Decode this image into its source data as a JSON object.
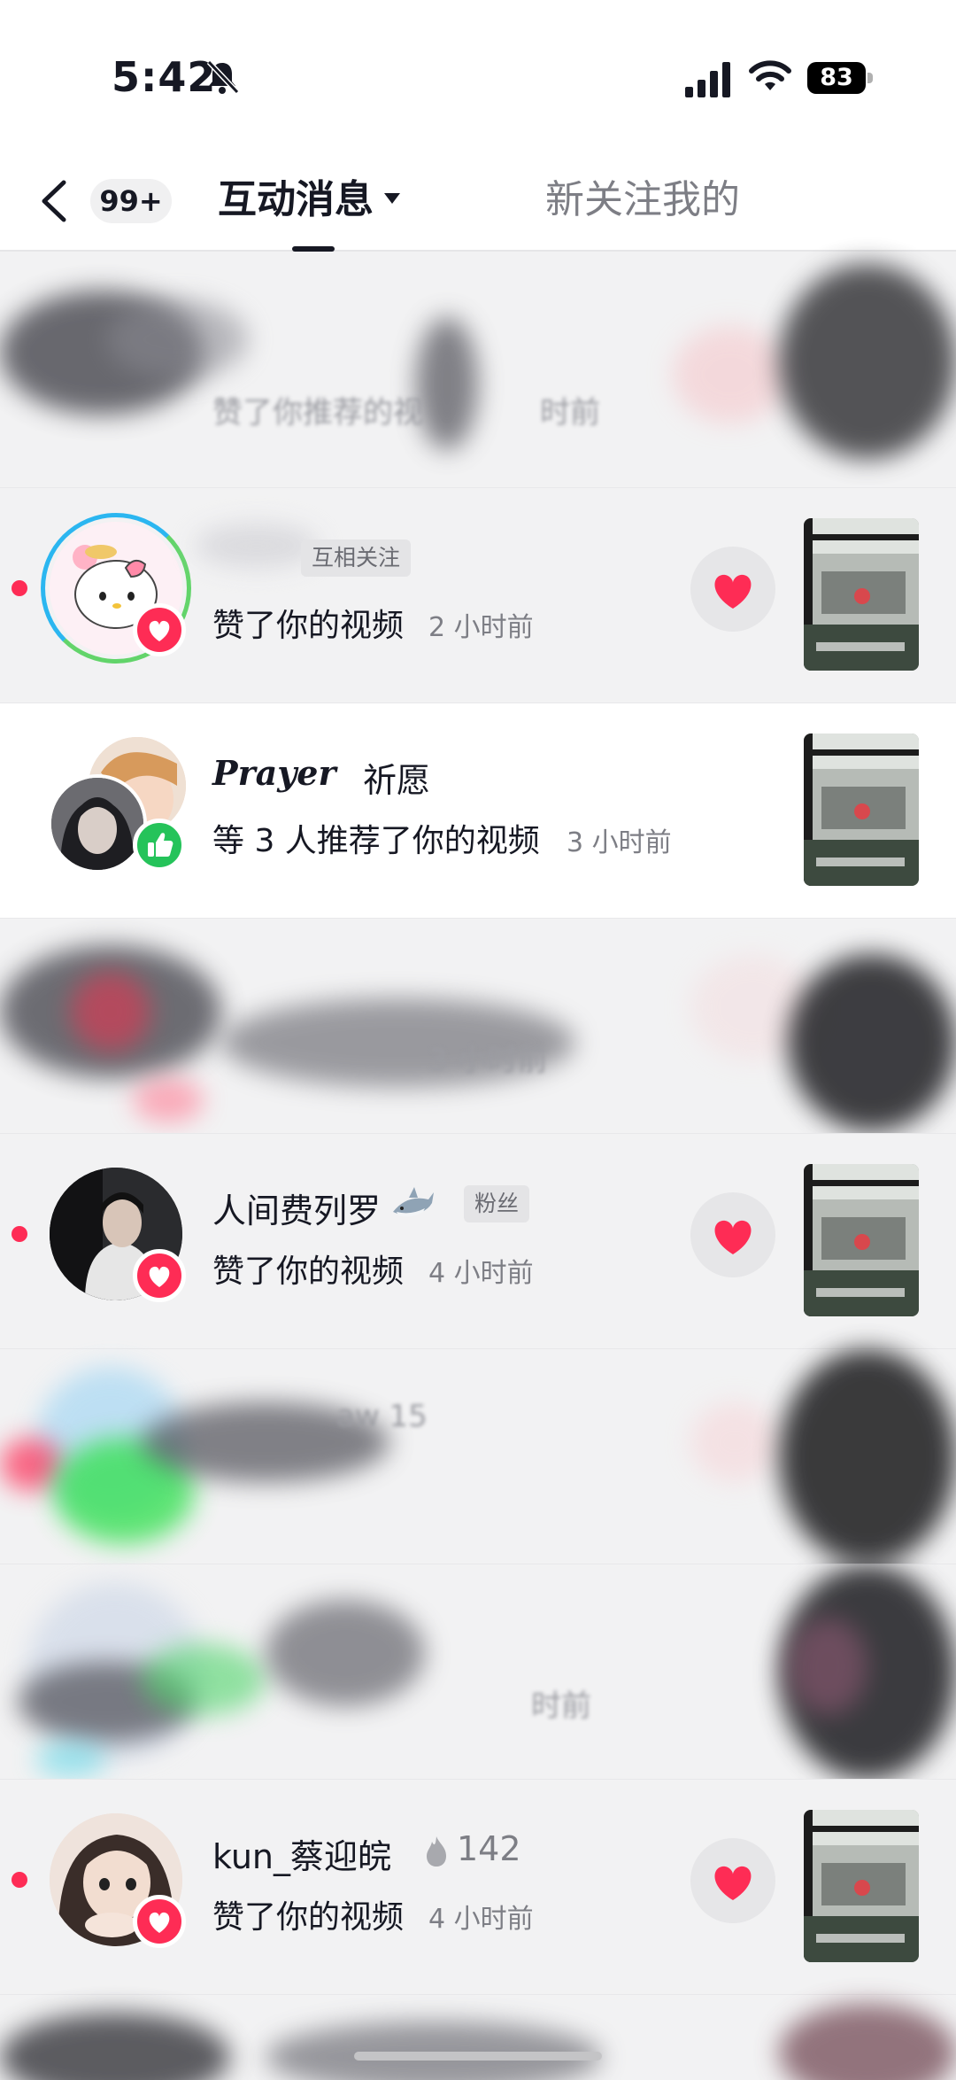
{
  "status_bar": {
    "time": "5:42",
    "battery": "83",
    "icons": [
      "bell-mute-icon",
      "cellular-signal-icon",
      "wifi-icon",
      "battery-icon"
    ]
  },
  "header": {
    "back_icon": "chevron-left-icon",
    "unread_count": "99+",
    "tab_active": "互动消息",
    "tab_inactive": "新关注我的"
  },
  "colors": {
    "accent_red": "#fe2c55",
    "like_green": "#25c35a",
    "text_primary": "#161823",
    "text_secondary": "#7d7e85",
    "background": "#f2f2f3"
  },
  "notifications": [
    {
      "blurred": true,
      "action": "赞了你推荐的视",
      "time": "时前"
    },
    {
      "blurred": false,
      "name": "",
      "tag": "互相关注",
      "action": "赞了你的视频",
      "time": "2 小时前",
      "unread": true,
      "badge": "heart"
    },
    {
      "blurred": false,
      "name_script": "Prayer",
      "name": "祈愿",
      "action": "等 3 人推荐了你的视频",
      "time": "3 小时前",
      "unread": false,
      "badge": "thumb"
    },
    {
      "blurred": true,
      "time": "3 小时前"
    },
    {
      "blurred": false,
      "name": "人间费列罗",
      "tag": "粉丝",
      "action": "赞了你的视频",
      "time": "4 小时前",
      "unread": true,
      "badge": "heart"
    },
    {
      "blurred": true,
      "name": "aw 15"
    },
    {
      "blurred": true,
      "time": "时前"
    },
    {
      "blurred": false,
      "name": "kun_蔡迎皖",
      "score": "142",
      "action": "赞了你的视频",
      "time": "4 小时前",
      "unread": true,
      "badge": "heart"
    }
  ]
}
